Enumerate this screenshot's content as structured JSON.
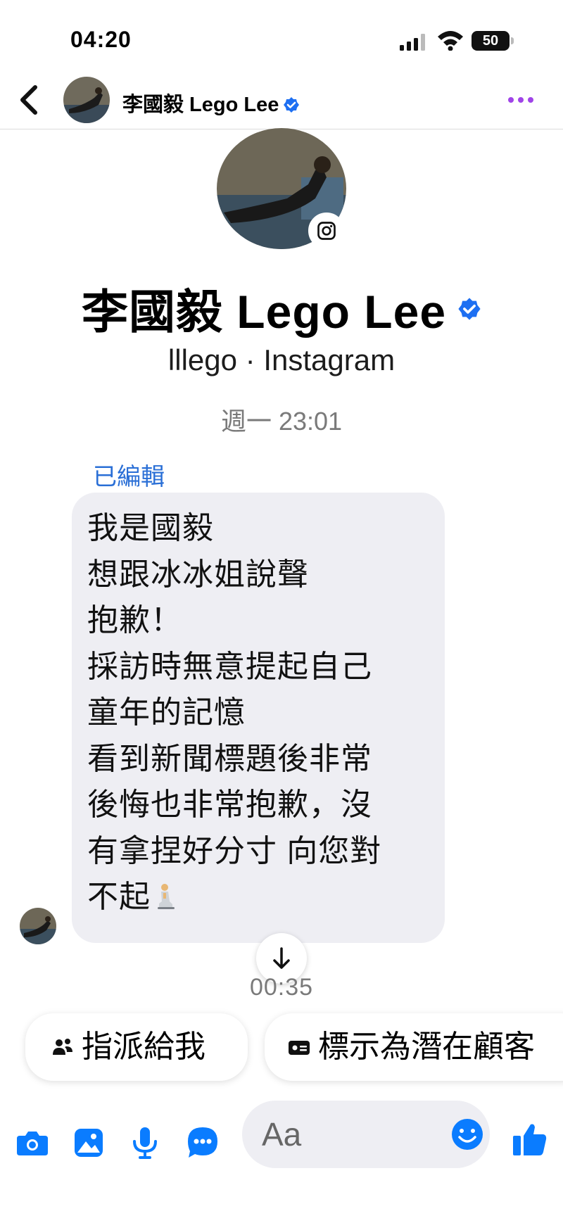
{
  "status_bar": {
    "time": "04:20",
    "battery": "50"
  },
  "header": {
    "name": "李國毅 Lego Lee",
    "verified": true
  },
  "profile": {
    "name": "李國毅 Lego Lee",
    "subtitle": "lllego · Instagram",
    "platform_icon": "instagram-icon"
  },
  "conversation": {
    "timestamp": "週一 23:01",
    "message": {
      "edited_label": "已編輯",
      "lines": [
        "我是國毅",
        "想跟冰冰姐說聲",
        "抱歉！",
        "採訪時無意提起自己",
        "童年的記憶",
        "看到新聞標題後非常",
        "後悔也非常抱歉，沒",
        "有拿捏好分寸 向您對",
        "不起"
      ],
      "trailing_emoji": "person-kneeling-icon"
    },
    "media_time": "00:35"
  },
  "quick_replies": [
    {
      "label": "指派給我",
      "icon": "people-icon"
    },
    {
      "label": "標示為潛在顧客",
      "icon": "id-card-icon"
    }
  ],
  "composer": {
    "placeholder": "Aa"
  },
  "colors": {
    "accent": "#0a7cff",
    "verified": "#1d6ff2",
    "more": "#a044e8",
    "bubble": "#eeeef3"
  }
}
